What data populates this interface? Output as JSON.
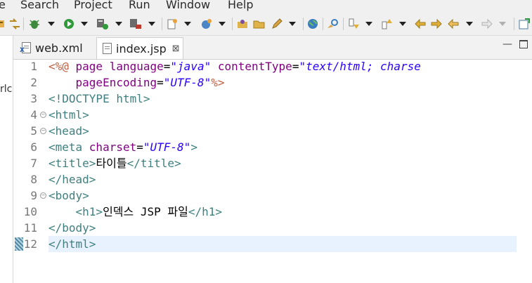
{
  "menubar": {
    "items": [
      "e",
      "Search",
      "Project",
      "Run",
      "Window",
      "Help"
    ]
  },
  "toolbar": {
    "icons": [
      "format-icon",
      "compare-icon",
      "debug-icon",
      "run-icon",
      "server-icon",
      "external-tools-icon",
      "new-file-icon",
      "new-type-icon",
      "open-project-icon",
      "open-folder-icon",
      "pen-icon",
      "globe-icon",
      "search-edit-icon",
      "next-annotation-icon",
      "prev-annotation-icon",
      "back-icon",
      "forward-icon",
      "pin-icon"
    ]
  },
  "left_panel": {
    "fragment": "rlc"
  },
  "tabs": [
    {
      "label": "web.xml",
      "active": false
    },
    {
      "label": "index.jsp",
      "active": true,
      "close": "⊠"
    }
  ],
  "editor": {
    "current_line": 12,
    "lines": [
      {
        "number": "1",
        "tokens": [
          [
            "jsp",
            "<%@ "
          ],
          [
            "attr",
            "page "
          ],
          [
            "attr",
            "language"
          ],
          [
            "txt",
            "="
          ],
          [
            "str",
            "\"java\""
          ],
          [
            "txt",
            " "
          ],
          [
            "attr",
            "contentType"
          ],
          [
            "txt",
            "="
          ],
          [
            "str",
            "\"text/html; charse"
          ]
        ]
      },
      {
        "number": "2",
        "tokens": [
          [
            "txt",
            "    "
          ],
          [
            "attr",
            "pageEncoding"
          ],
          [
            "txt",
            "="
          ],
          [
            "str",
            "\"UTF-8\""
          ],
          [
            "jsp",
            "%>"
          ]
        ]
      },
      {
        "number": "3",
        "tokens": [
          [
            "tag",
            "<!DOCTYPE html>"
          ]
        ]
      },
      {
        "number": "4",
        "fold": true,
        "tokens": [
          [
            "tag",
            "<html>"
          ]
        ]
      },
      {
        "number": "5",
        "fold": true,
        "tokens": [
          [
            "tag",
            "<head>"
          ]
        ]
      },
      {
        "number": "6",
        "tokens": [
          [
            "tag",
            "<meta "
          ],
          [
            "attr",
            "charset"
          ],
          [
            "txt",
            "="
          ],
          [
            "str",
            "\"UTF-8\""
          ],
          [
            "tag",
            ">"
          ]
        ]
      },
      {
        "number": "7",
        "tokens": [
          [
            "tag",
            "<title>"
          ],
          [
            "txt",
            "타이틀"
          ],
          [
            "tag",
            "</title>"
          ]
        ]
      },
      {
        "number": "8",
        "tokens": [
          [
            "tag",
            "</head>"
          ]
        ]
      },
      {
        "number": "9",
        "fold": true,
        "tokens": [
          [
            "tag",
            "<body>"
          ]
        ]
      },
      {
        "number": "10",
        "tokens": [
          [
            "txt",
            "    "
          ],
          [
            "tag",
            "<h1>"
          ],
          [
            "txt",
            "인덱스 JSP 파일"
          ],
          [
            "tag",
            "</h1>"
          ]
        ]
      },
      {
        "number": "11",
        "tokens": [
          [
            "tag",
            "</body>"
          ]
        ]
      },
      {
        "number": "12",
        "tokens": [
          [
            "tag",
            "</html>"
          ]
        ]
      }
    ]
  },
  "colors": {
    "jsp_delimiter": "#bf5f3f",
    "tag": "#3f7f7f",
    "attribute": "#7f007f",
    "string": "#2a00ff",
    "current_line": "#e8f2fe"
  }
}
